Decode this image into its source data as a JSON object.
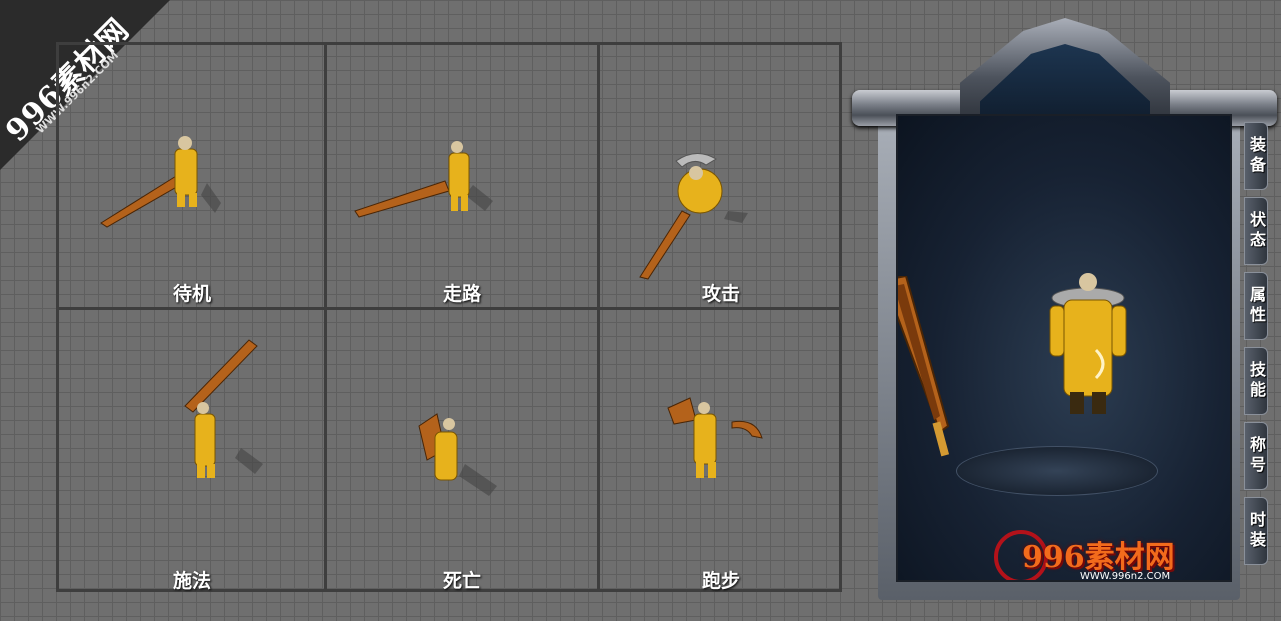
{
  "watermark": {
    "brand": "996素材网",
    "url": "WWW.996n2.COM"
  },
  "animations": [
    {
      "label": "待机"
    },
    {
      "label": "走路"
    },
    {
      "label": "攻击"
    },
    {
      "label": "施法"
    },
    {
      "label": "死亡"
    },
    {
      "label": "跑步"
    }
  ],
  "panel": {
    "tabs": [
      "装备",
      "状态",
      "属性",
      "技能",
      "称号",
      "时装"
    ],
    "logo_text": "996素材网",
    "logo_url": "WWW.996n2.COM"
  },
  "colors": {
    "robe": "#e7b21c",
    "weapon": "#b4621b",
    "grid_line": "#3e3e3e",
    "background": "#6f6f6f"
  }
}
